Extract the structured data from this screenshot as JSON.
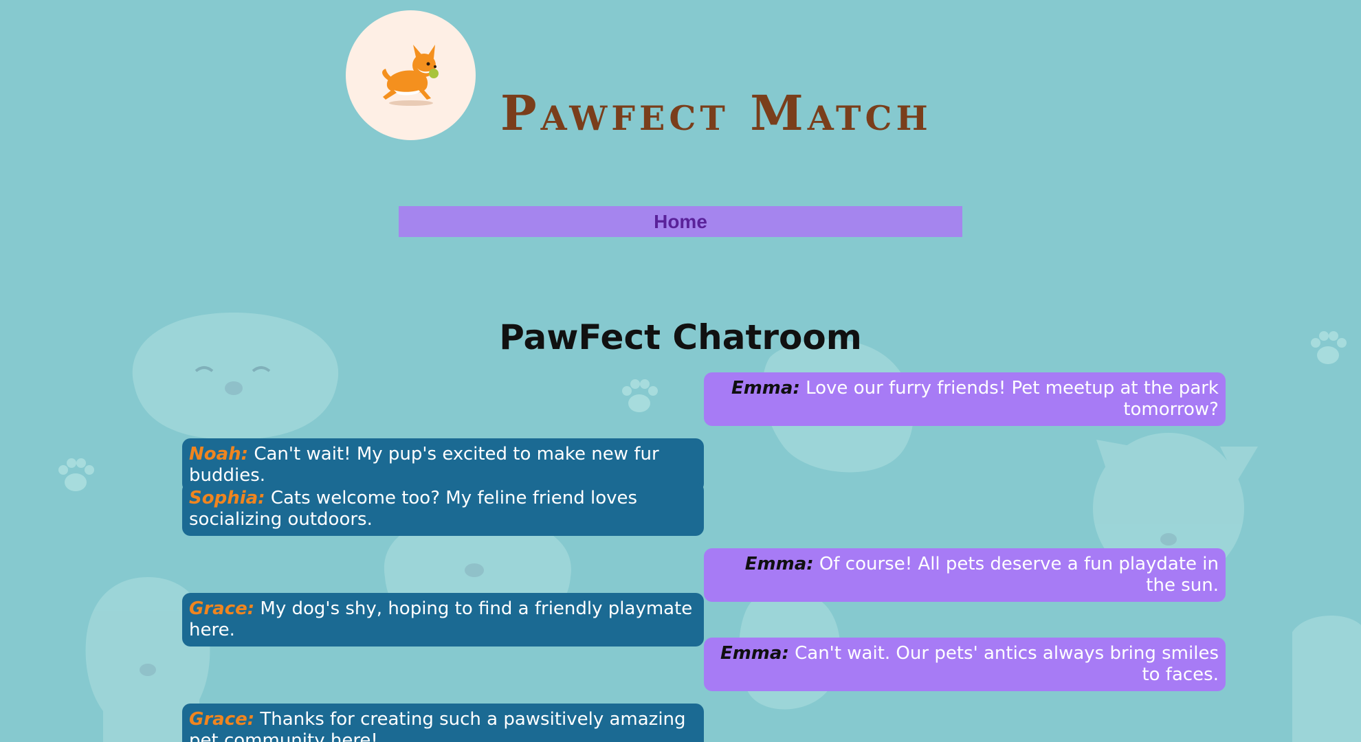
{
  "header": {
    "title": "Pawfect Match",
    "logo": "corgi-dog-logo"
  },
  "nav": {
    "home_label": "Home"
  },
  "chat": {
    "title": "PawFect Chatroom",
    "messages": [
      {
        "side": "right",
        "author": "Emma:",
        "text": "Love our furry friends! Pet meetup at the park tomorrow?"
      },
      {
        "side": "left",
        "author": "Noah:",
        "text": "Can't wait! My pup's excited to make new fur buddies."
      },
      {
        "side": "left",
        "author": "Sophia:",
        "text": "Cats welcome too? My feline friend loves socializing outdoors."
      },
      {
        "side": "right",
        "author": "Emma:",
        "text": "Of course! All pets deserve a fun playdate in the sun."
      },
      {
        "side": "left",
        "author": "Grace:",
        "text": "My dog's shy, hoping to find a friendly playmate here."
      },
      {
        "side": "right",
        "author": "Emma:",
        "text": "Can't wait. Our pets' antics always bring smiles to faces."
      },
      {
        "side": "left",
        "author": "Grace:",
        "text": "Thanks for creating such a pawsitively amazing pet community here!"
      }
    ]
  },
  "colors": {
    "background": "#86c9cf",
    "title_brown": "#7a3e1b",
    "nav_purple": "#a585ee",
    "left_bubble": "#1b6a93",
    "right_bubble": "#a77bf5",
    "left_author": "#f0851f"
  }
}
